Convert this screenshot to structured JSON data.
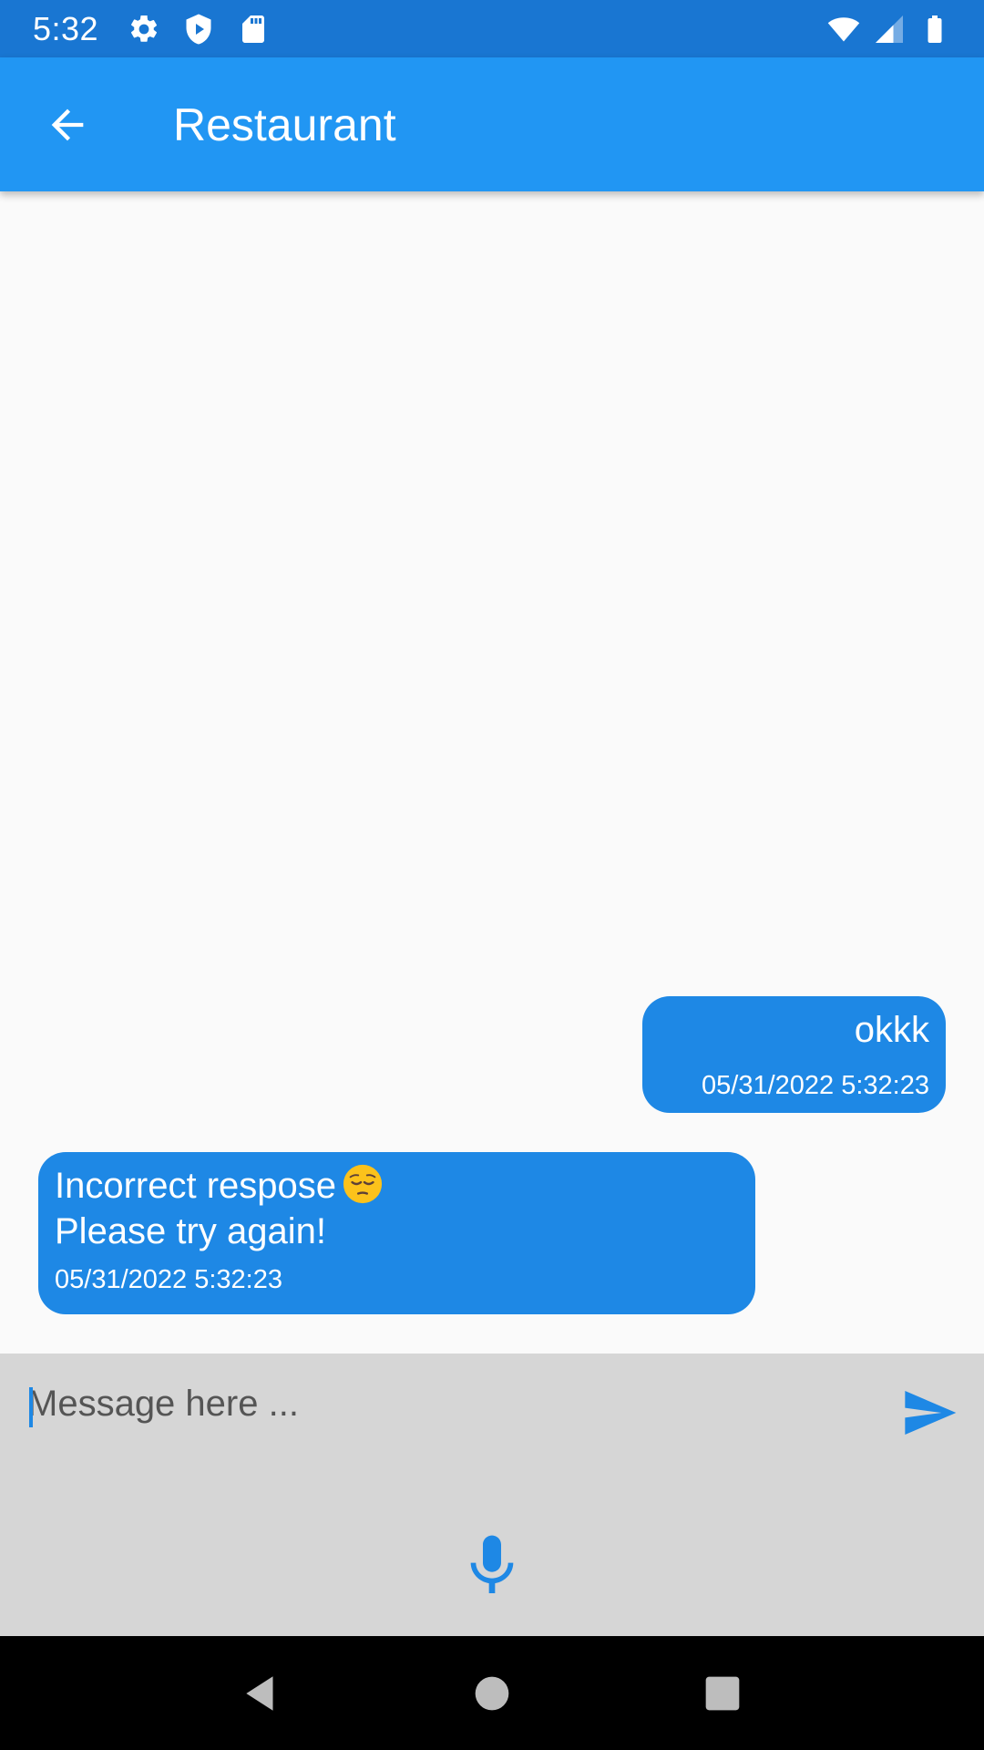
{
  "status_bar": {
    "time": "5:32",
    "left_icons": [
      "settings-icon",
      "play-protect-icon",
      "sd-card-icon"
    ],
    "right_icons": [
      "wifi-icon",
      "signal-icon",
      "battery-icon"
    ]
  },
  "app_bar": {
    "title": "Restaurant",
    "back_icon": "arrow-back-icon",
    "background_color": "#2196f3"
  },
  "messages": [
    {
      "direction": "outgoing",
      "text": "okkk",
      "timestamp": "05/31/2022 5:32:23"
    },
    {
      "direction": "incoming",
      "text": "Incorrect respose",
      "emoji": "pensive-face-icon",
      "text_line2": "Please try again!",
      "timestamp": "05/31/2022 5:32:23"
    }
  ],
  "composer": {
    "placeholder": "Message here ...",
    "value": "",
    "send_icon": "send-icon",
    "mic_icon": "microphone-icon"
  },
  "colors": {
    "status_bar": "#1976d2",
    "app_bar": "#2196f3",
    "bubble": "#1e88e5",
    "composer_bg": "#d6d6d6"
  }
}
